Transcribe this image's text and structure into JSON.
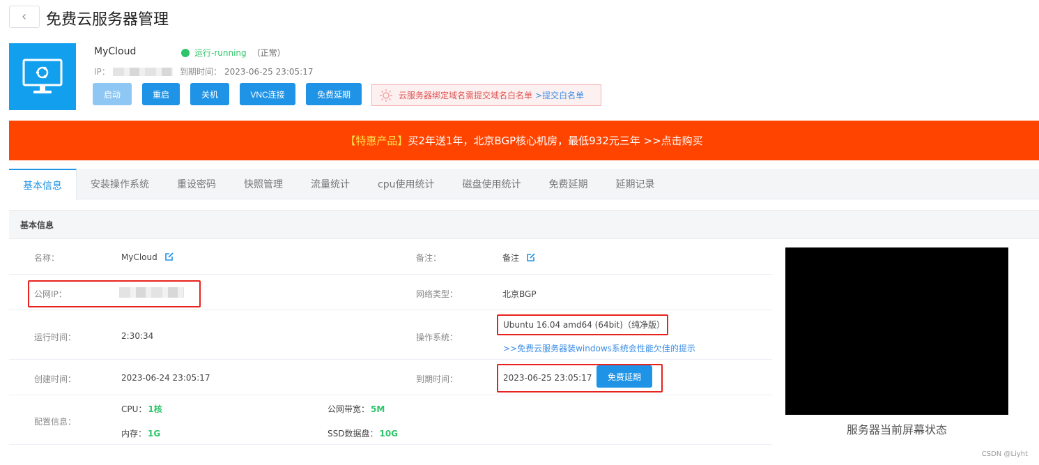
{
  "header": {
    "back_icon": "chevron-left-icon",
    "title": "免费云服务器管理"
  },
  "server": {
    "name": "MyCloud",
    "status": "运行-running",
    "status_note": "（正常）",
    "status_color": "#2ec56a",
    "ip_label": "IP：",
    "expire_label": "到期时间：",
    "expire_value": "2023-06-25 23:05:17",
    "icon": "monitor-ubuntu-icon",
    "brand_color": "#12a0ee"
  },
  "actions": {
    "start": "启动",
    "restart": "重启",
    "shutdown": "关机",
    "vnc": "VNC连接",
    "extend": "免费延期"
  },
  "notice": {
    "icon": "lightbulb-icon",
    "text": "云服务器绑定域名需提交域名白名单",
    "link": ">提交白名单"
  },
  "banner": {
    "highlight": "【特惠产品】",
    "text": "买2年送1年，北京BGP核心机房，最低932元三年 >>点击购买",
    "bg_color": "#ff4400"
  },
  "tabs": [
    "基本信息",
    "安装操作系统",
    "重设密码",
    "快照管理",
    "流量统计",
    "cpu使用统计",
    "磁盘使用统计",
    "免费延期",
    "延期记录"
  ],
  "panel": {
    "title": "基本信息"
  },
  "info": {
    "name_label": "名称：",
    "name_value": "MyCloud",
    "remark_label": "备注：",
    "remark_value": "备注",
    "public_ip_label": "公网IP：",
    "network_label": "网络类型：",
    "network_value": "北京BGP",
    "uptime_label": "运行时间：",
    "uptime_value": "2:30:34",
    "os_label": "操作系统：",
    "os_value": "Ubuntu 16.04 amd64 (64bit)（纯净版）",
    "os_link": ">>免费云服务器装windows系统会性能欠佳的提示",
    "created_label": "创建时间：",
    "created_value": "2023-06-24 23:05:17",
    "expire_label": "到期时间：",
    "expire_value": "2023-06-25 23:05:17",
    "extend_button": "免费延期",
    "config_label": "配置信息：",
    "cpu_label": "CPU：",
    "cpu_value": "1核",
    "bandwidth_label": "公网带宽：",
    "bandwidth_value": "5M",
    "memory_label": "内存：",
    "memory_value": "1G",
    "ssd_label": "SSD数据盘：",
    "ssd_value": "10G"
  },
  "screen": {
    "caption": "服务器当前屏幕状态"
  },
  "watermark": "CSDN @Liyht"
}
